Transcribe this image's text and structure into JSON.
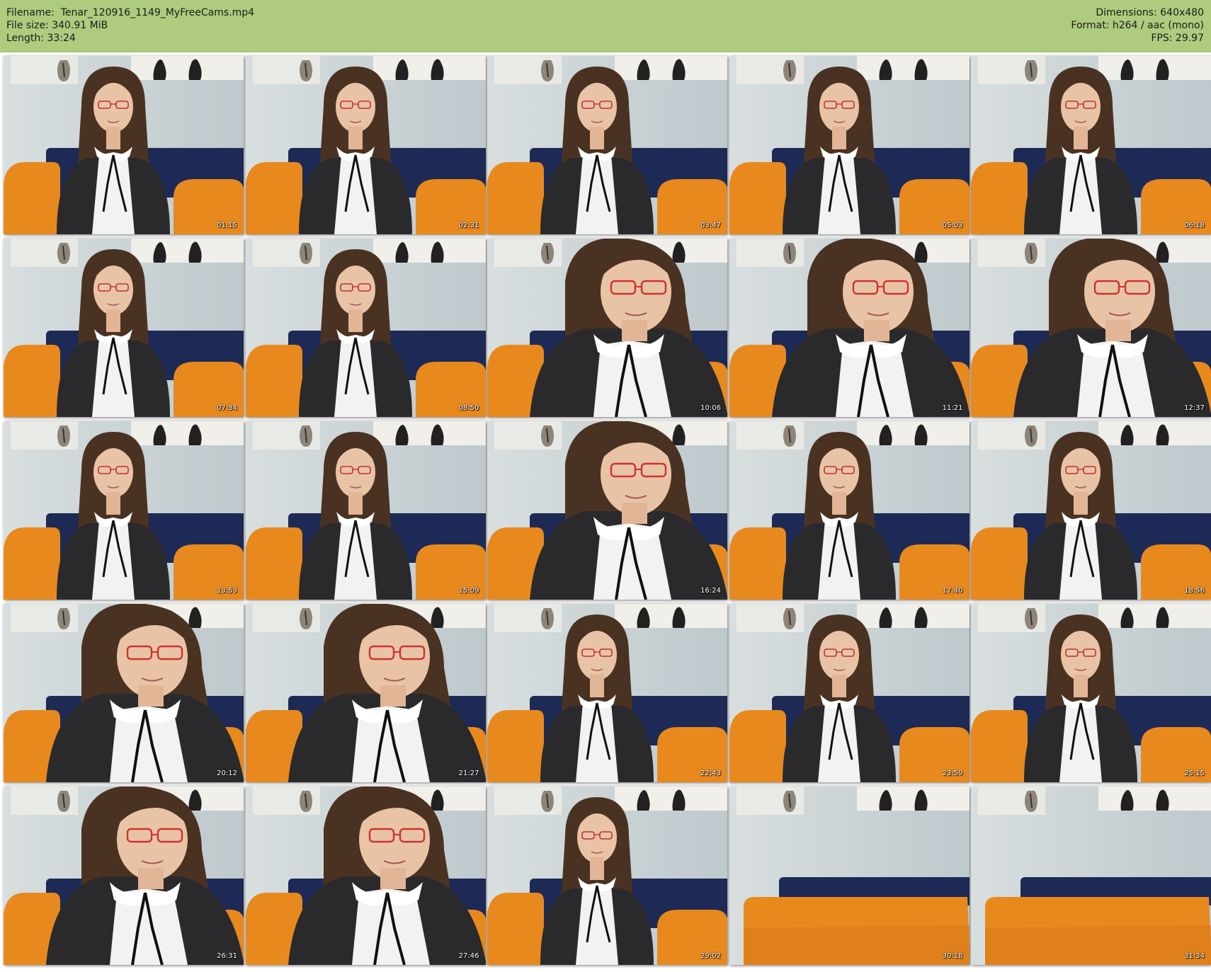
{
  "header": {
    "filename_label": "Filename:",
    "filename": "Tenar_120916_1149_MyFreeCams.mp4",
    "filesize_label": "File size:",
    "filesize": "340.91 MiB",
    "length_label": "Length:",
    "length": "33:24",
    "dimensions_label": "Dimensions:",
    "dimensions": "640x480",
    "format_label": "Format:",
    "format": "h264 / aac (mono)",
    "fps_label": "FPS:",
    "fps": "29.97"
  },
  "colors": {
    "header_bg": "#aecb7e",
    "wall": "#c9d3d6",
    "couch_orange": "#e8891e",
    "couch_blue": "#1d2a55",
    "jacket": "#2a2a2c",
    "hair": "#4a3222"
  },
  "thumbnails": [
    {
      "time": "01:15",
      "shot": "wide",
      "person": true
    },
    {
      "time": "02:31",
      "shot": "wide",
      "person": true
    },
    {
      "time": "03:47",
      "shot": "wide",
      "person": true
    },
    {
      "time": "05:03",
      "shot": "wide",
      "person": true
    },
    {
      "time": "06:18",
      "shot": "wide",
      "person": true
    },
    {
      "time": "07:34",
      "shot": "wide",
      "person": true
    },
    {
      "time": "08:50",
      "shot": "wide",
      "person": true
    },
    {
      "time": "10:06",
      "shot": "close",
      "person": true
    },
    {
      "time": "11:21",
      "shot": "close",
      "person": true
    },
    {
      "time": "12:37",
      "shot": "close",
      "person": true
    },
    {
      "time": "13:53",
      "shot": "wide",
      "person": true
    },
    {
      "time": "15:09",
      "shot": "wide",
      "person": true
    },
    {
      "time": "16:24",
      "shot": "close",
      "person": true
    },
    {
      "time": "17:40",
      "shot": "wide",
      "person": true
    },
    {
      "time": "18:56",
      "shot": "wide",
      "person": true
    },
    {
      "time": "20:12",
      "shot": "close",
      "person": true
    },
    {
      "time": "21:27",
      "shot": "close",
      "person": true
    },
    {
      "time": "22:43",
      "shot": "wide",
      "person": true
    },
    {
      "time": "23:59",
      "shot": "wide",
      "person": true
    },
    {
      "time": "25:15",
      "shot": "wide",
      "person": true
    },
    {
      "time": "26:31",
      "shot": "close",
      "person": true
    },
    {
      "time": "27:46",
      "shot": "close",
      "person": true
    },
    {
      "time": "29:02",
      "shot": "wide",
      "person": true
    },
    {
      "time": "30:18",
      "shot": "empty",
      "person": false
    },
    {
      "time": "31:34",
      "shot": "empty",
      "person": false
    }
  ]
}
